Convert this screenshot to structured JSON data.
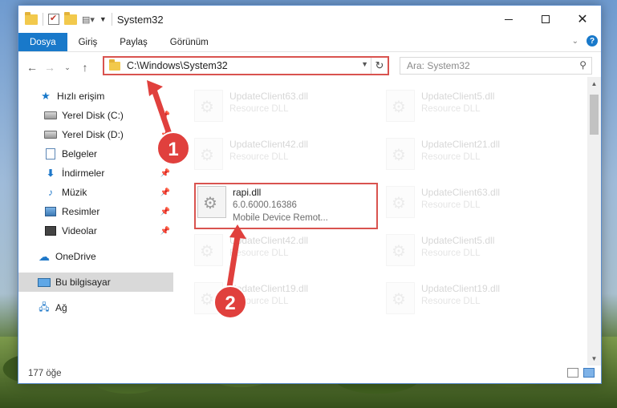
{
  "window": {
    "title": "System32"
  },
  "ribbon": {
    "tabs": [
      "Dosya",
      "Giriş",
      "Paylaş",
      "Görünüm"
    ]
  },
  "address": {
    "path": "C:\\Windows\\System32",
    "search_placeholder": "Ara: System32"
  },
  "nav": {
    "items": [
      {
        "label": "Hızlı erişim",
        "icon": "star-icon"
      },
      {
        "label": "Yerel Disk (C:)",
        "icon": "drive-icon",
        "pinned": true
      },
      {
        "label": "Yerel Disk (D:)",
        "icon": "drive-icon",
        "pinned": true
      },
      {
        "label": "Belgeler",
        "icon": "documents-icon",
        "pinned": true
      },
      {
        "label": "İndirmeler",
        "icon": "download-icon",
        "pinned": true
      },
      {
        "label": "Müzik",
        "icon": "music-icon",
        "pinned": true
      },
      {
        "label": "Resimler",
        "icon": "pictures-icon",
        "pinned": true
      },
      {
        "label": "Videolar",
        "icon": "videos-icon",
        "pinned": true
      },
      {
        "label": "OneDrive",
        "icon": "cloud-icon"
      },
      {
        "label": "Bu bilgisayar",
        "icon": "computer-icon",
        "selected": true
      },
      {
        "label": "Ağ",
        "icon": "network-icon"
      }
    ]
  },
  "files": [
    {
      "name": "UpdateClient63.dll",
      "sub1": "Resource DLL",
      "sub2": ""
    },
    {
      "name": "UpdateClient5.dll",
      "sub1": "Resource DLL",
      "sub2": ""
    },
    {
      "name": "UpdateClient42.dll",
      "sub1": "Resource DLL",
      "sub2": ""
    },
    {
      "name": "UpdateClient21.dll",
      "sub1": "Resource DLL",
      "sub2": ""
    },
    {
      "name": "rapi.dll",
      "sub1": "6.0.6000.16386",
      "sub2": "Mobile Device Remot..."
    },
    {
      "name": "UpdateClient63.dll",
      "sub1": "Resource DLL",
      "sub2": ""
    },
    {
      "name": "UpdateClient42.dll",
      "sub1": "Resource DLL",
      "sub2": ""
    },
    {
      "name": "UpdateClient5.dll",
      "sub1": "Resource DLL",
      "sub2": ""
    },
    {
      "name": "UpdateClient19.dll",
      "sub1": "Resource DLL",
      "sub2": ""
    },
    {
      "name": "UpdateClient19.dll",
      "sub1": "Resource DLL",
      "sub2": ""
    }
  ],
  "status": {
    "count": "177 öğe"
  },
  "annotations": {
    "step1": "1",
    "step2": "2",
    "color": "#d9534f"
  }
}
